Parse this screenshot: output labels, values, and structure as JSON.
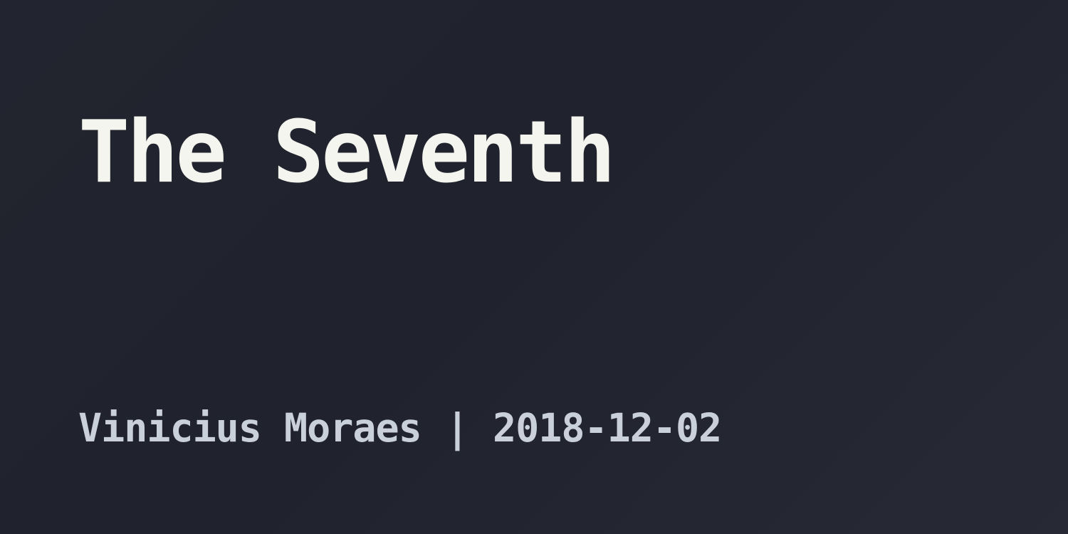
{
  "post": {
    "title": "The Seventh",
    "author": "Vinicius Moraes",
    "separator": " | ",
    "date": "2018-12-02"
  },
  "colors": {
    "background": "#22242f",
    "title": "#f4f5ee",
    "meta": "#c9d0da"
  }
}
